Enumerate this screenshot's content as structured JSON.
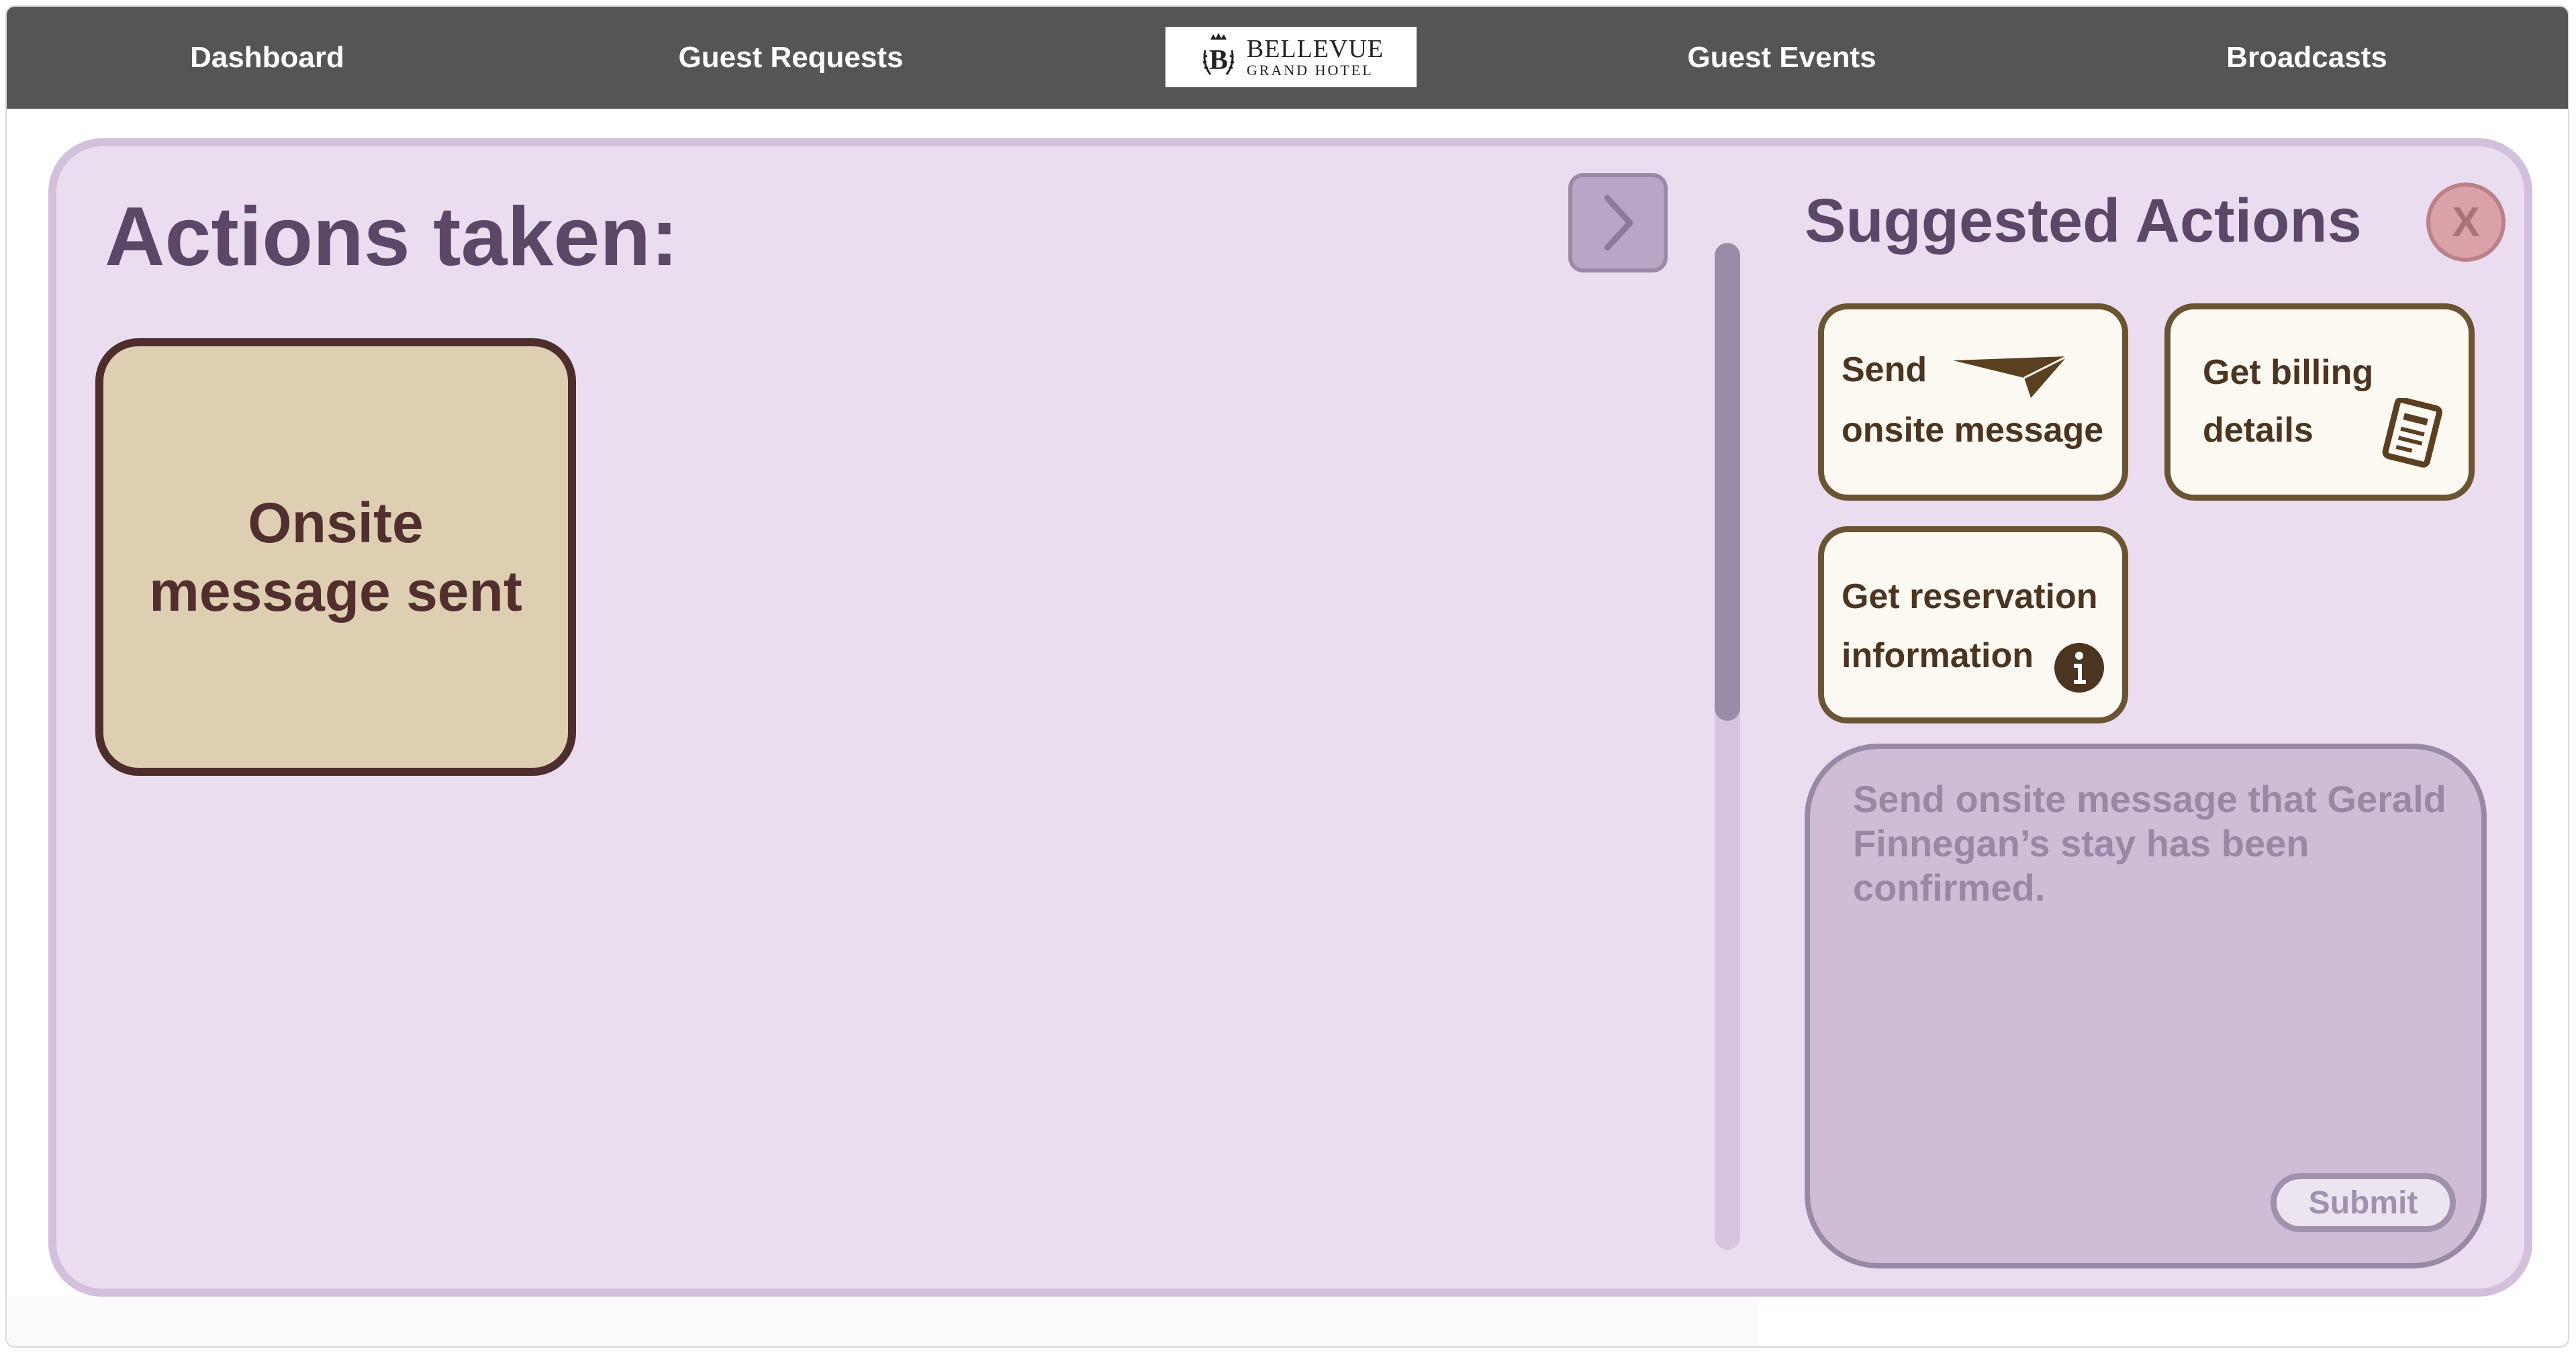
{
  "nav": {
    "items": [
      "Dashboard",
      "Guest Requests",
      "Guest Events",
      "Broadcasts"
    ],
    "logo": {
      "monogram": "B",
      "name": "BELLEVUE",
      "subtitle": "GRAND HOTEL"
    }
  },
  "actions_panel": {
    "title": "Actions taken:",
    "cards": [
      {
        "label": "Onsite message sent"
      }
    ],
    "collapse_icon": "chevron-right-icon"
  },
  "suggested": {
    "title": "Suggested Actions",
    "close_label": "X",
    "items": [
      {
        "line1": "Send",
        "line2": "onsite message",
        "icon": "paper-plane-icon"
      },
      {
        "line1": "Get billing",
        "line2": "details",
        "icon": "document-icon"
      },
      {
        "line1": "Get reservation",
        "line2": "information",
        "icon": "info-icon"
      }
    ],
    "prompt_value": "Send onsite message that Gerald Finnegan’s stay has been confirmed.",
    "submit_label": "Submit"
  },
  "colors": {
    "nav_bg": "#555555",
    "panel_bg": "#e9ddef",
    "panel_border": "#d2c0dc",
    "action_card_bg": "#decfb2",
    "action_card_border": "#4e2d2d",
    "suggestion_border": "#6b5434",
    "prompt_bg": "#cfbdd7",
    "close_bg": "#dba1a8"
  }
}
